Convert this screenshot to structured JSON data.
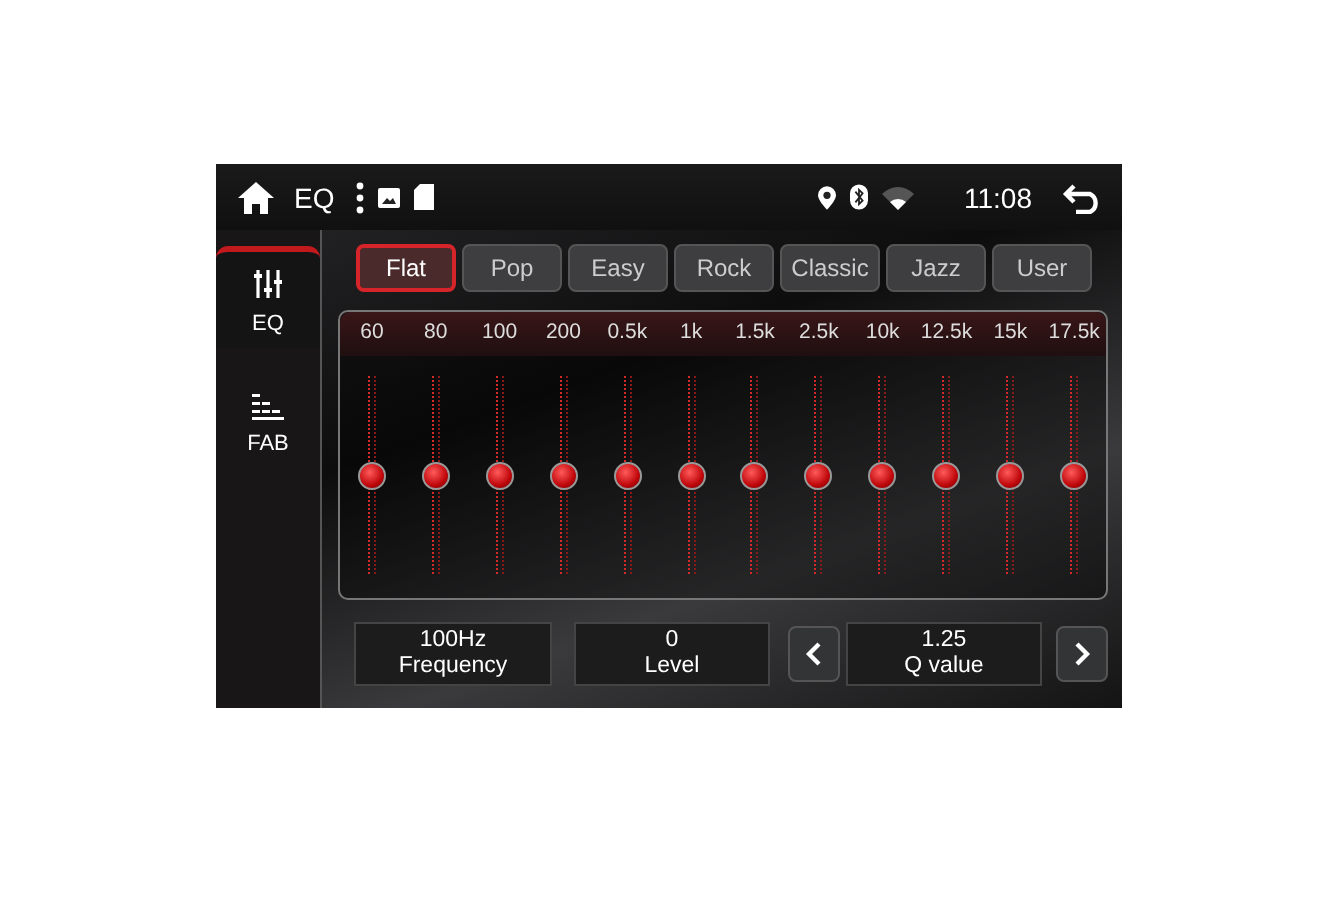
{
  "status_bar": {
    "title": "EQ",
    "time": "11:08"
  },
  "sidebar": {
    "items": [
      {
        "label": "EQ",
        "kind": "eq",
        "selected": true
      },
      {
        "label": "FAB",
        "kind": "fab",
        "selected": false
      }
    ]
  },
  "presets": [
    {
      "label": "Flat",
      "selected": true
    },
    {
      "label": "Pop",
      "selected": false
    },
    {
      "label": "Easy",
      "selected": false
    },
    {
      "label": "Rock",
      "selected": false
    },
    {
      "label": "Classic",
      "selected": false
    },
    {
      "label": "Jazz",
      "selected": false
    },
    {
      "label": "User",
      "selected": false
    }
  ],
  "bands": [
    {
      "label": "60",
      "level": 0.5
    },
    {
      "label": "80",
      "level": 0.5
    },
    {
      "label": "100",
      "level": 0.5
    },
    {
      "label": "200",
      "level": 0.5
    },
    {
      "label": "0.5k",
      "level": 0.5
    },
    {
      "label": "1k",
      "level": 0.5
    },
    {
      "label": "1.5k",
      "level": 0.5
    },
    {
      "label": "2.5k",
      "level": 0.5
    },
    {
      "label": "10k",
      "level": 0.5
    },
    {
      "label": "12.5k",
      "level": 0.5
    },
    {
      "label": "15k",
      "level": 0.5
    },
    {
      "label": "17.5k",
      "level": 0.5
    }
  ],
  "readouts": [
    {
      "kind": "value",
      "value": "100Hz",
      "label": "Frequency"
    },
    {
      "kind": "value",
      "value": "0",
      "label": "Level"
    },
    {
      "kind": "prev"
    },
    {
      "kind": "value",
      "value": "1.25",
      "label": "Q value"
    },
    {
      "kind": "next"
    }
  ]
}
